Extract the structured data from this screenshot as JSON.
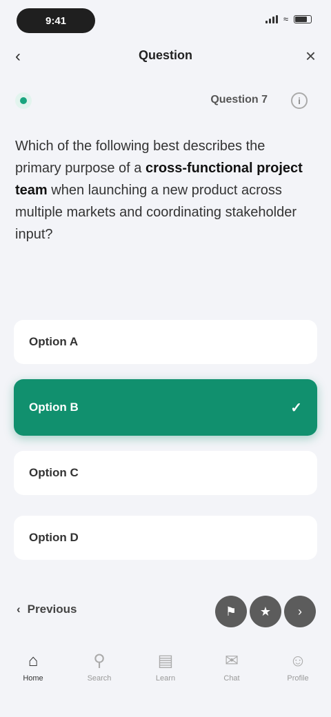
{
  "status_bar": {
    "time": "9:41"
  },
  "nav": {
    "title": "Question",
    "back_icon": "chevron-left-icon",
    "close_icon": "close-icon"
  },
  "meta": {
    "progress": "Question 7",
    "info_icon": "info-icon"
  },
  "question": {
    "part1": "Which of the following best describes the primary purpose of a ",
    "bold": "cross-functional project team",
    "part2": " when launching a new product across multiple markets and coordinating stakeholder input?"
  },
  "options": [
    {
      "label": "Option A",
      "selected": false
    },
    {
      "label": "Option B",
      "selected": true
    },
    {
      "label": "Option C",
      "selected": false
    },
    {
      "label": "Option D",
      "selected": false
    }
  ],
  "footer": {
    "prev_label": "Previous",
    "buttons": [
      "flag-icon",
      "bookmark-icon",
      "next-icon"
    ]
  },
  "tabs": [
    {
      "icon": "home-icon",
      "label": "Home"
    },
    {
      "icon": "search-icon",
      "label": "Search"
    },
    {
      "icon": "book-icon",
      "label": "Learn"
    },
    {
      "icon": "chat-icon",
      "label": "Chat"
    },
    {
      "icon": "profile-icon",
      "label": "Profile"
    }
  ],
  "colors": {
    "accent": "#11906e",
    "background": "#f3f4f8"
  }
}
